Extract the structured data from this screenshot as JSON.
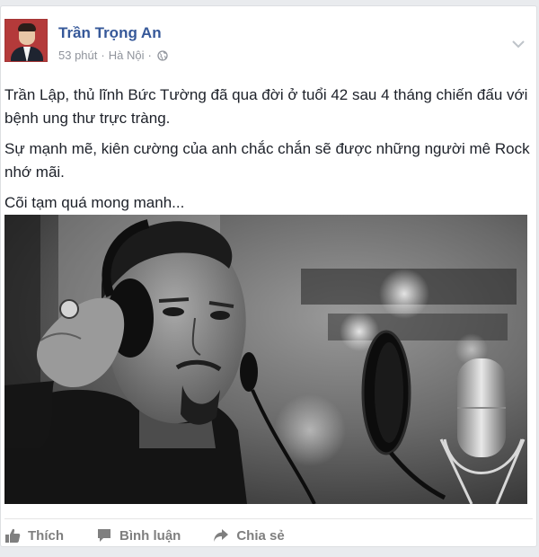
{
  "post": {
    "author": "Trần Trọng An",
    "time": "53 phút",
    "separator": "·",
    "location": "Hà Nội",
    "privacy_icon": "globe-icon",
    "menu_icon": "chevron-down-icon",
    "paragraphs": [
      "Trần Lập, thủ lĩnh Bức Tường đã qua đời ở tuổi 42 sau 4 tháng chiến đấu với bệnh ung thư trực tràng.",
      "Sự mạnh mẽ, kiên cường của anh chắc chắn sẽ được những người mê Rock nhớ mãi.",
      "Cõi tạm quá mong manh..."
    ]
  },
  "actions": {
    "like_label": "Thích",
    "comment_label": "Bình luận",
    "share_label": "Chia sẻ"
  },
  "colors": {
    "author_link": "#365899",
    "meta": "#90949c",
    "action_text": "#7f7f7f"
  }
}
